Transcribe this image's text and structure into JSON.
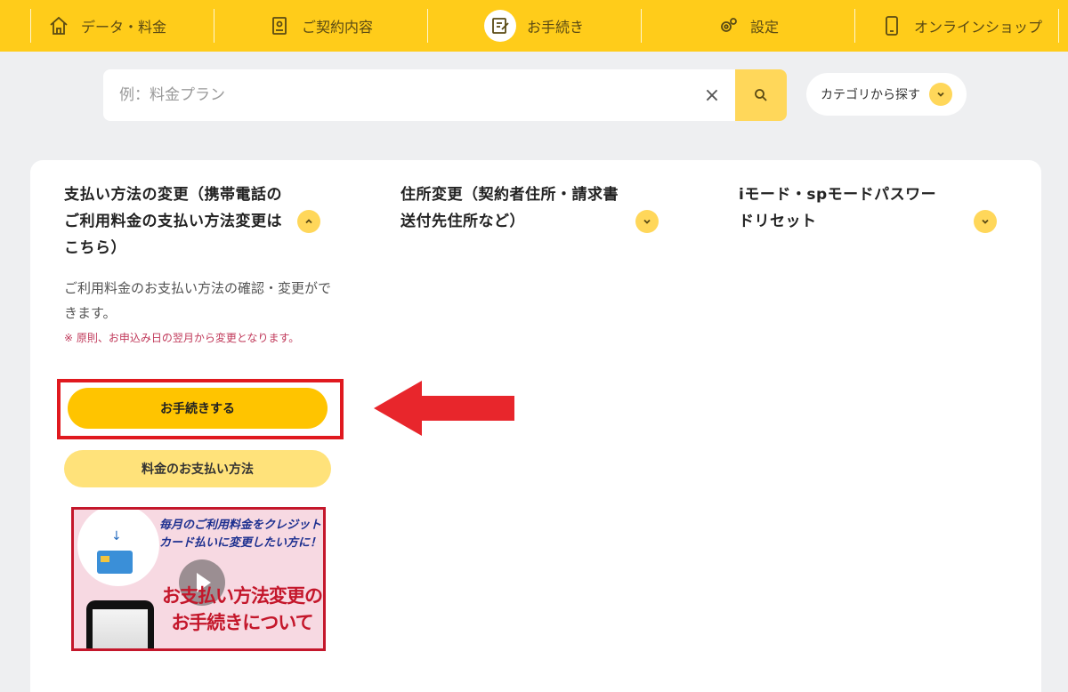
{
  "nav": {
    "items": [
      {
        "label": "データ・料金",
        "icon": "home-icon"
      },
      {
        "label": "ご契約内容",
        "icon": "contract-icon"
      },
      {
        "label": "お手続き",
        "icon": "procedure-icon",
        "active": true
      },
      {
        "label": "設定",
        "icon": "settings-icon"
      },
      {
        "label": "オンラインショップ",
        "icon": "smartphone-icon"
      }
    ]
  },
  "search": {
    "placeholder": "例：料金プラン",
    "clear_label": "×",
    "category_label": "カテゴリから探す"
  },
  "columns": [
    {
      "title": "支払い方法の変更（携帯電話のご利用料金の支払い方法変更はこちら）",
      "expanded": true
    },
    {
      "title": "住所変更（契約者住所・請求書送付先住所など）",
      "expanded": false
    },
    {
      "title": "iモード・spモードパスワードリセット",
      "expanded": false
    }
  ],
  "detail": {
    "description": "ご利用料金のお支払い方法の確認・変更ができます。",
    "note": "※ 原則、お申込み日の翌月から変更となります。",
    "primary_button": "お手続きする",
    "secondary_button": "料金のお支払い方法"
  },
  "video": {
    "caption": "毎月のご利用料金をクレジットカード払いに変更したい方に！",
    "title": "お支払い方法変更のお手続きについて"
  },
  "colors": {
    "brand_yellow": "#ffcc1a",
    "button_yellow": "#ffc400",
    "highlight_red": "#e0191f"
  }
}
